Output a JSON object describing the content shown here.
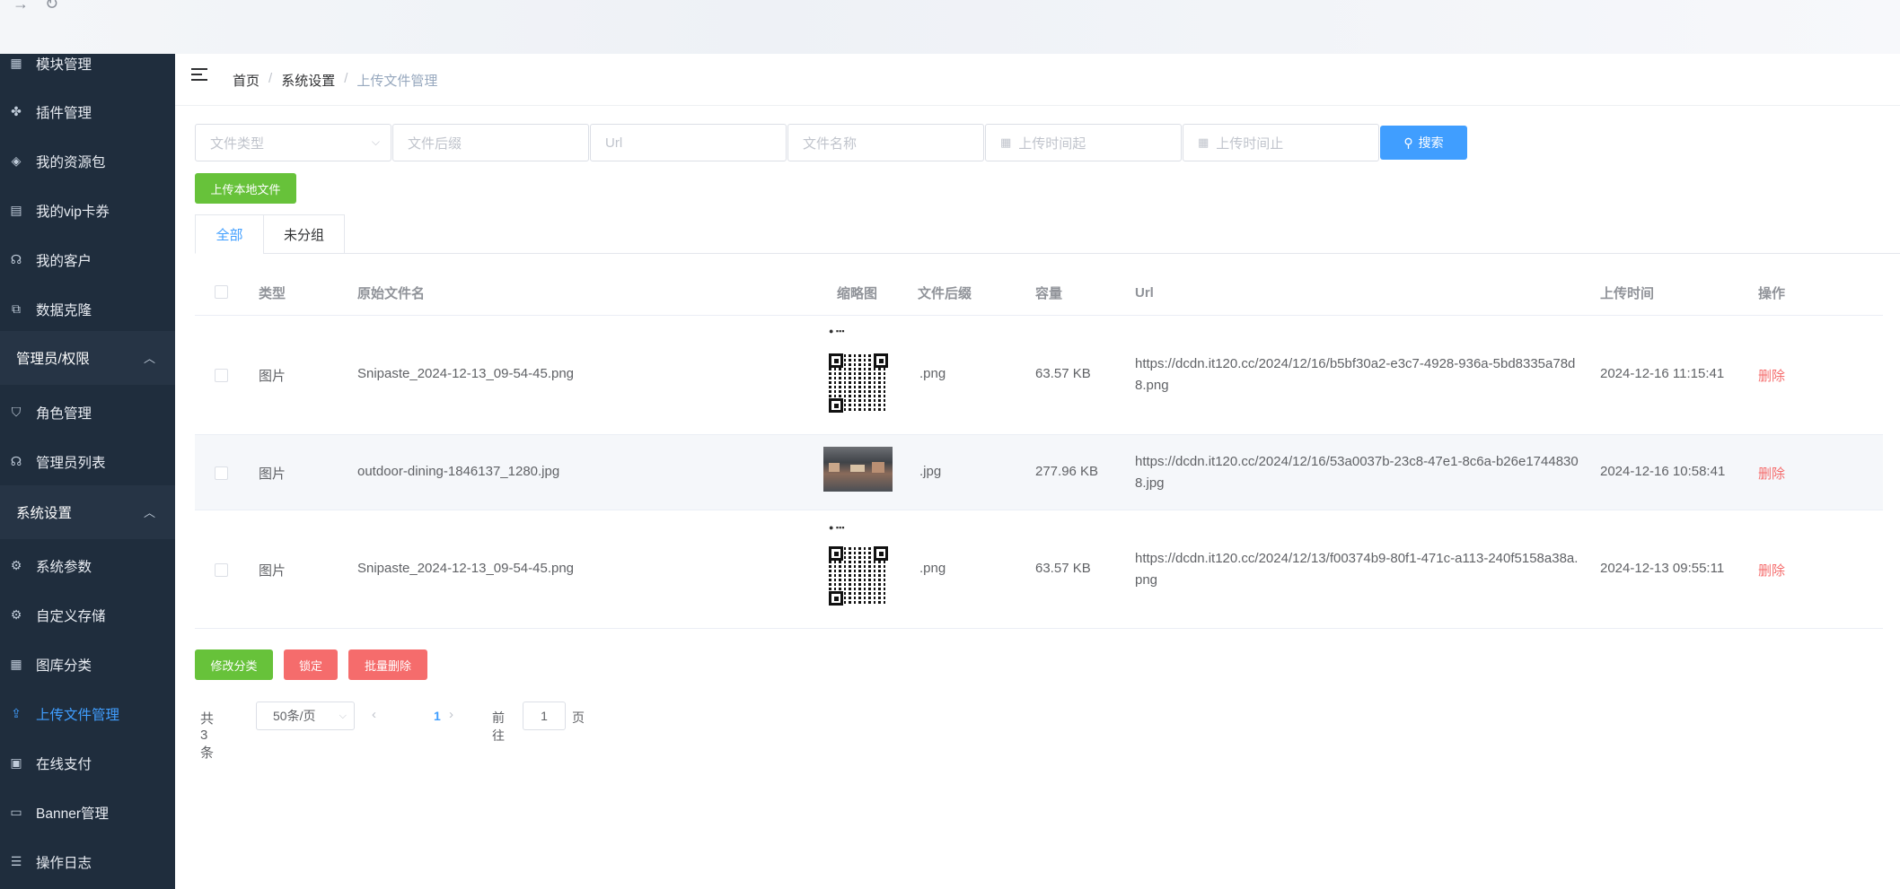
{
  "browser": {
    "back_icon": "→",
    "reload_icon": "↻"
  },
  "sidebar": {
    "items_top": [
      {
        "label": "模块管理",
        "icon": "grid-icon"
      },
      {
        "label": "插件管理",
        "icon": "puzzle-icon"
      },
      {
        "label": "我的资源包",
        "icon": "package-icon"
      },
      {
        "label": "我的vip卡券",
        "icon": "coupon-icon"
      },
      {
        "label": "我的客户",
        "icon": "headset-icon"
      },
      {
        "label": "数据克隆",
        "icon": "copy-icon"
      }
    ],
    "group_admin": "管理员/权限",
    "items_admin": [
      {
        "label": "角色管理",
        "icon": "shield-icon"
      },
      {
        "label": "管理员列表",
        "icon": "headset-icon"
      }
    ],
    "group_system": "系统设置",
    "items_system": [
      {
        "label": "系统参数",
        "icon": "gear-icon"
      },
      {
        "label": "自定义存储",
        "icon": "gear-icon"
      },
      {
        "label": "图库分类",
        "icon": "grid-icon"
      },
      {
        "label": "上传文件管理",
        "icon": "upload-icon",
        "active": true
      },
      {
        "label": "在线支付",
        "icon": "wallet-icon"
      },
      {
        "label": "Banner管理",
        "icon": "monitor-icon"
      },
      {
        "label": "操作日志",
        "icon": "document-icon"
      }
    ]
  },
  "breadcrumb": {
    "home": "首页",
    "settings": "系统设置",
    "current": "上传文件管理",
    "separator": "/"
  },
  "filters": {
    "file_type_placeholder": "文件类型",
    "suffix_placeholder": "文件后缀",
    "url_placeholder": "Url",
    "name_placeholder": "文件名称",
    "start_placeholder": "上传时间起",
    "end_placeholder": "上传时间止",
    "search_label": "搜索"
  },
  "upload_button": "上传本地文件",
  "tabs": [
    {
      "label": "全部",
      "active": true
    },
    {
      "label": "未分组"
    }
  ],
  "table": {
    "headers": {
      "type": "类型",
      "name": "原始文件名",
      "thumb": "缩略图",
      "suffix": "文件后缀",
      "size": "容量",
      "url": "Url",
      "time": "上传时间",
      "op": "操作"
    },
    "rows": [
      {
        "type": "图片",
        "name": "Snipaste_2024-12-13_09-54-45.png",
        "thumb": "qr-code",
        "suffix": ".png",
        "size": "63.57 KB",
        "url": "https://dcdn.it120.cc/2024/12/16/b5bf30a2-e3c7-4928-936a-5bd8335a78d8.png",
        "time": "2024-12-16 11:15:41",
        "op": "删除"
      },
      {
        "type": "图片",
        "name": "outdoor-dining-1846137_1280.jpg",
        "thumb": "photo",
        "suffix": ".jpg",
        "size": "277.96 KB",
        "url": "https://dcdn.it120.cc/2024/12/16/53a0037b-23c8-47e1-8c6a-b26e17448308.jpg",
        "time": "2024-12-16 10:58:41",
        "op": "删除"
      },
      {
        "type": "图片",
        "name": "Snipaste_2024-12-13_09-54-45.png",
        "thumb": "qr-code",
        "suffix": ".png",
        "size": "63.57 KB",
        "url": "https://dcdn.it120.cc/2024/12/13/f00374b9-80f1-471c-a113-240f5158a38a.png",
        "time": "2024-12-13 09:55:11",
        "op": "删除"
      }
    ]
  },
  "bulk_actions": {
    "change_category": "修改分类",
    "lock": "锁定",
    "batch_delete": "批量删除"
  },
  "pagination": {
    "total": "共 3 条",
    "page_size": "50条/页",
    "current_page": "1",
    "goto_label": "前往",
    "goto_value": "1",
    "page_unit": "页"
  },
  "colors": {
    "sidebar_bg": "#1f2d3d",
    "accent": "#409eff",
    "success": "#67c23a",
    "danger": "#f56c6c"
  }
}
